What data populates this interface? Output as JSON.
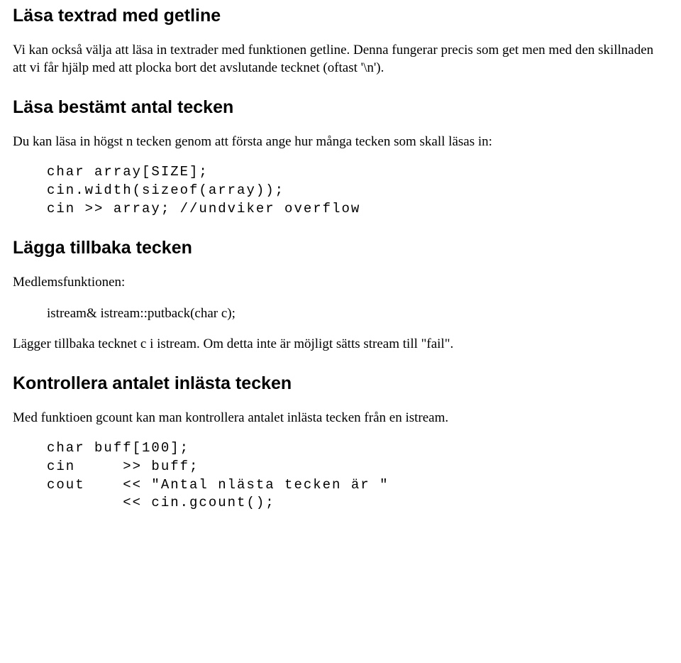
{
  "sections": {
    "s1": {
      "heading": "Läsa textrad med getline",
      "p1": "Vi kan också välja att läsa in textrader med funktionen getline. Denna fungerar precis som get men med den skillnaden att vi får hjälp med att plocka bort det avslutande tecknet (oftast '\\n')."
    },
    "s2": {
      "heading": "Läsa bestämt antal tecken",
      "p1": "Du kan läsa in högst n tecken genom att första ange hur många tecken som skall läsas in:",
      "code": "char array[SIZE];\ncin.width(sizeof(array));\ncin >> array; //undviker overflow"
    },
    "s3": {
      "heading": "Lägga tillbaka tecken",
      "p1": "Medlemsfunktionen:",
      "sig": "istream& istream::putback(char c);",
      "p2": "Lägger tillbaka tecknet c i istream. Om detta inte är möjligt sätts stream till \"fail\"."
    },
    "s4": {
      "heading": "Kontrollera antalet inlästa tecken",
      "p1": "Med funktioen gcount kan man kontrollera antalet inlästa tecken från en istream.",
      "code": "char buff[100];\ncin     >> buff;\ncout    << \"Antal nlästa tecken är \"\n        << cin.gcount();"
    }
  }
}
